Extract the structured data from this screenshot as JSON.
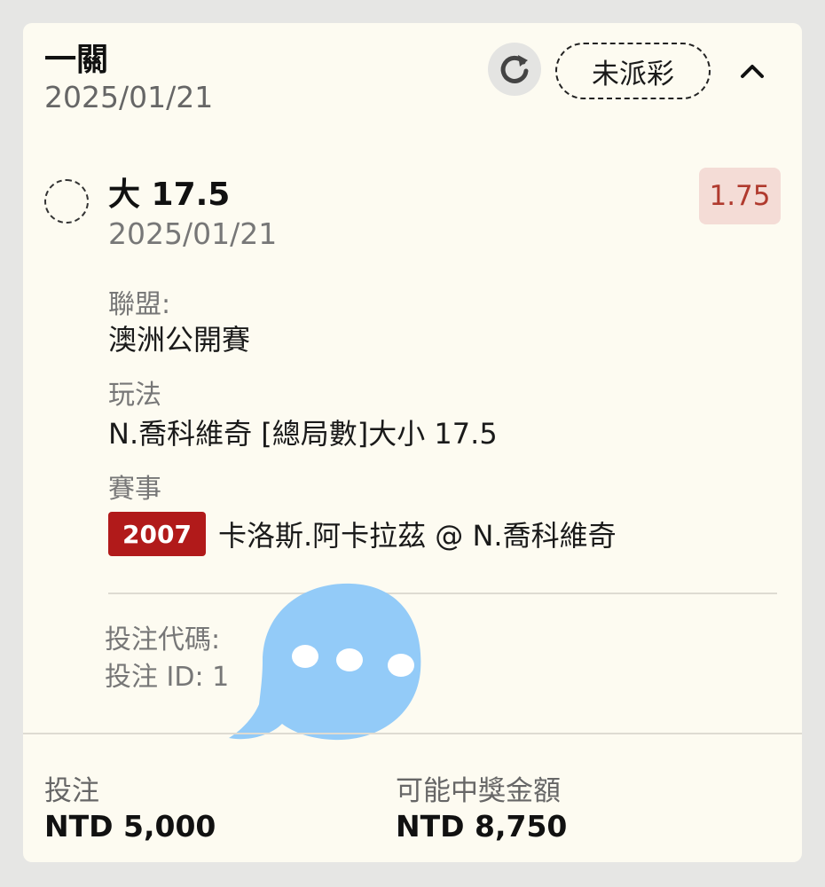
{
  "header": {
    "title": "一關",
    "date": "2025/01/21",
    "status": "未派彩",
    "refresh_icon": "refresh-icon",
    "collapse_icon": "chevron-up-icon"
  },
  "selection": {
    "name": "大 17.5",
    "date": "2025/01/21",
    "odds": "1.75"
  },
  "details": {
    "league_label": "聯盟:",
    "league_value": "澳洲公開賽",
    "market_label": "玩法",
    "market_value": "N.喬科維奇 [總局數]大小 17.5",
    "event_label": "賽事",
    "event_code": "2007",
    "event_name": "卡洛斯.阿卡拉茲 @ N.喬科維奇"
  },
  "bet_ref": {
    "code_label": "投注代碼:",
    "id_label": "投注 ID: 1"
  },
  "footer": {
    "stake_label": "投注",
    "stake_value": "NTD 5,000",
    "payout_label": "可能中獎金額",
    "payout_value": "NTD 8,750"
  },
  "colors": {
    "card_bg": "#fdfbf1",
    "odds_bg": "#f4dcd6",
    "odds_text": "#b03a2e",
    "event_badge": "#b11a1a",
    "chat_bubble": "#93cbf8"
  }
}
